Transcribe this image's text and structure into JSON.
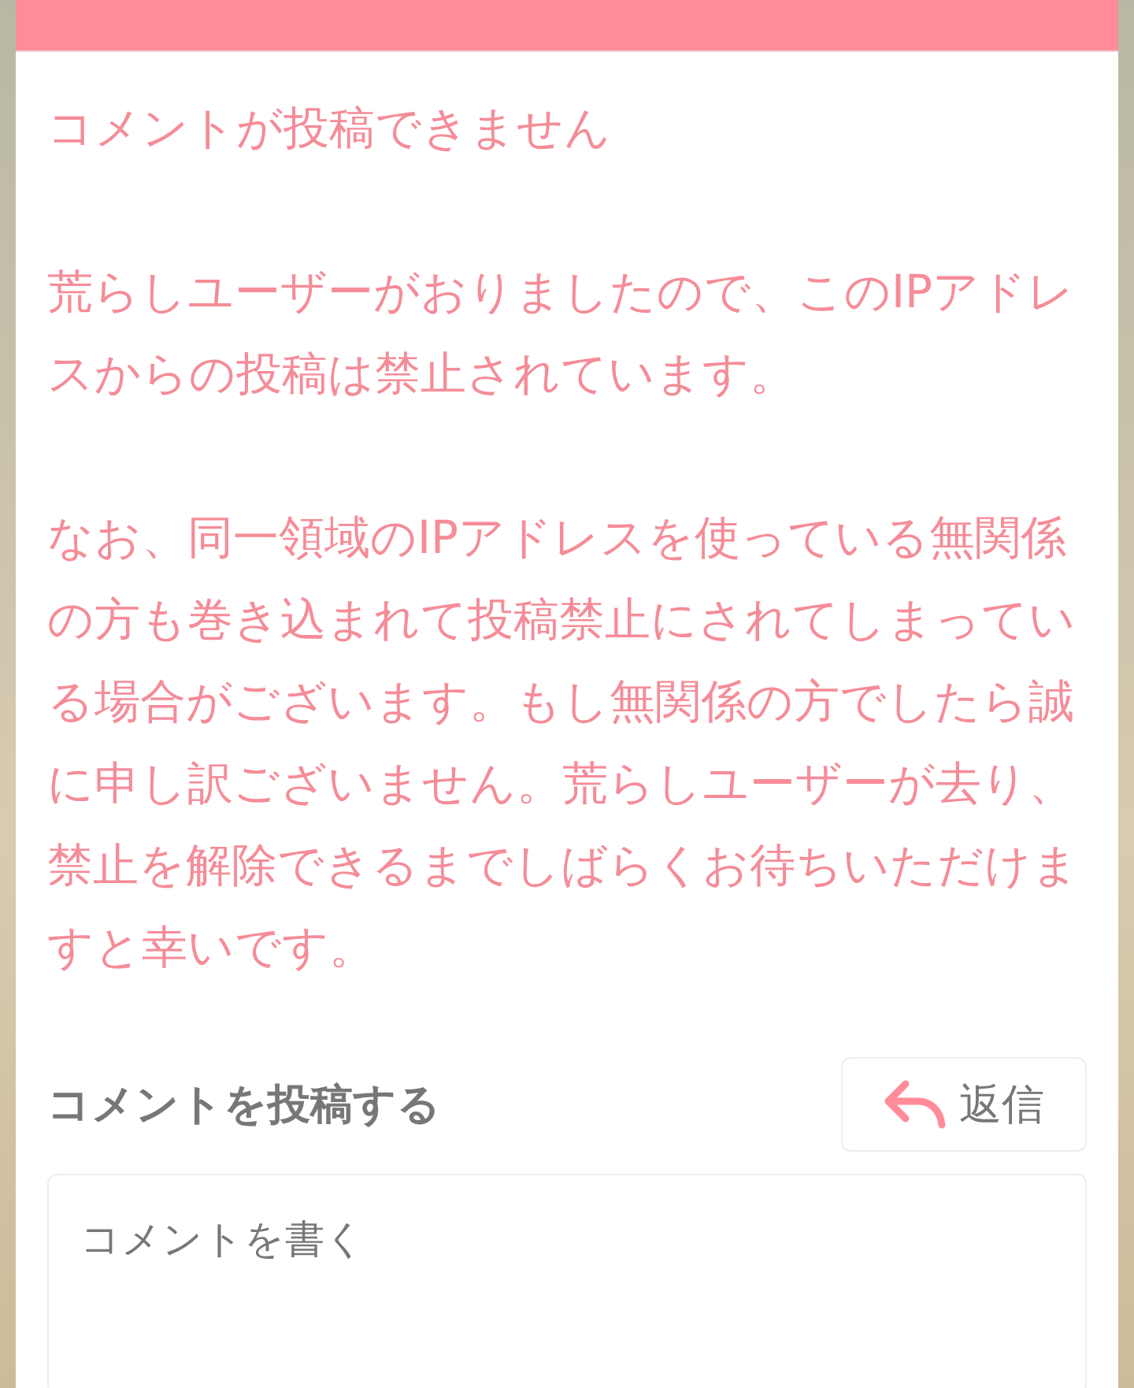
{
  "notice": {
    "title": "コメントが投稿できません",
    "paragraphs": [
      "荒らしユーザーがおりましたので、このIPアドレスからの投稿は禁止されています。",
      "なお、同一領域のIPアドレスを使っている無関係の方も巻き込まれて投稿禁止にされてしまっている場合がございます。もし無関係の方でしたら誠に申し訳ございません。荒らしユーザーが去り、禁止を解除できるまでしばらくお待ちいただけますと幸いです。"
    ]
  },
  "comment_form": {
    "heading": "コメントを投稿する",
    "reply_button": "返信",
    "placeholder": "コメントを書く"
  }
}
